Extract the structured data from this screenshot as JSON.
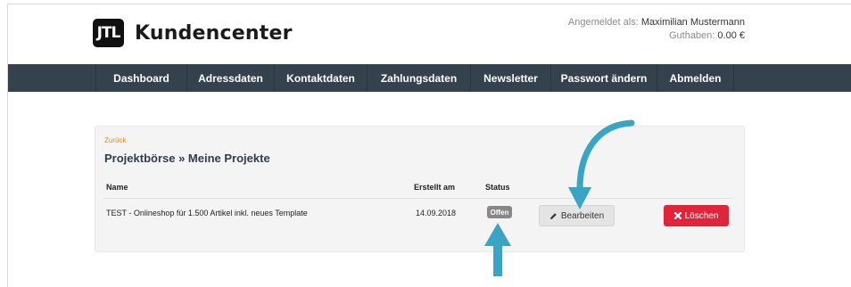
{
  "header": {
    "logo_mark": "JTL",
    "app_title": "Kundencenter",
    "logged_in_label": "Angemeldet als:",
    "user_name": "Maximilian Mustermann",
    "balance_label": "Guthaben:",
    "balance_value": "0.00 €"
  },
  "nav": {
    "items": [
      {
        "label": "Dashboard"
      },
      {
        "label": "Adressdaten"
      },
      {
        "label": "Kontaktdaten"
      },
      {
        "label": "Zahlungsdaten"
      },
      {
        "label": "Newsletter"
      },
      {
        "label": "Passwort ändern"
      },
      {
        "label": "Abmelden"
      }
    ],
    "background": "#34424d"
  },
  "content": {
    "back_link": "Zurück",
    "title": "Projektbörse » Meine Projekte",
    "table": {
      "headers": {
        "name": "Name",
        "created": "Erstellt am",
        "status": "Status"
      },
      "rows": [
        {
          "name": "TEST - Onlineshop für 1.500 Artikel inkl. neues Template",
          "created": "14.09.2018",
          "status": "Offen",
          "edit_label": "Bearbeiten",
          "delete_label": "Löschen"
        }
      ]
    }
  },
  "colors": {
    "accent_link": "#e8862a",
    "delete_button": "#e0243a",
    "annotation_arrow": "#3aa4c4",
    "status_badge": "#888888"
  },
  "icons": {
    "edit": "pencil-icon",
    "delete": "x-icon"
  }
}
